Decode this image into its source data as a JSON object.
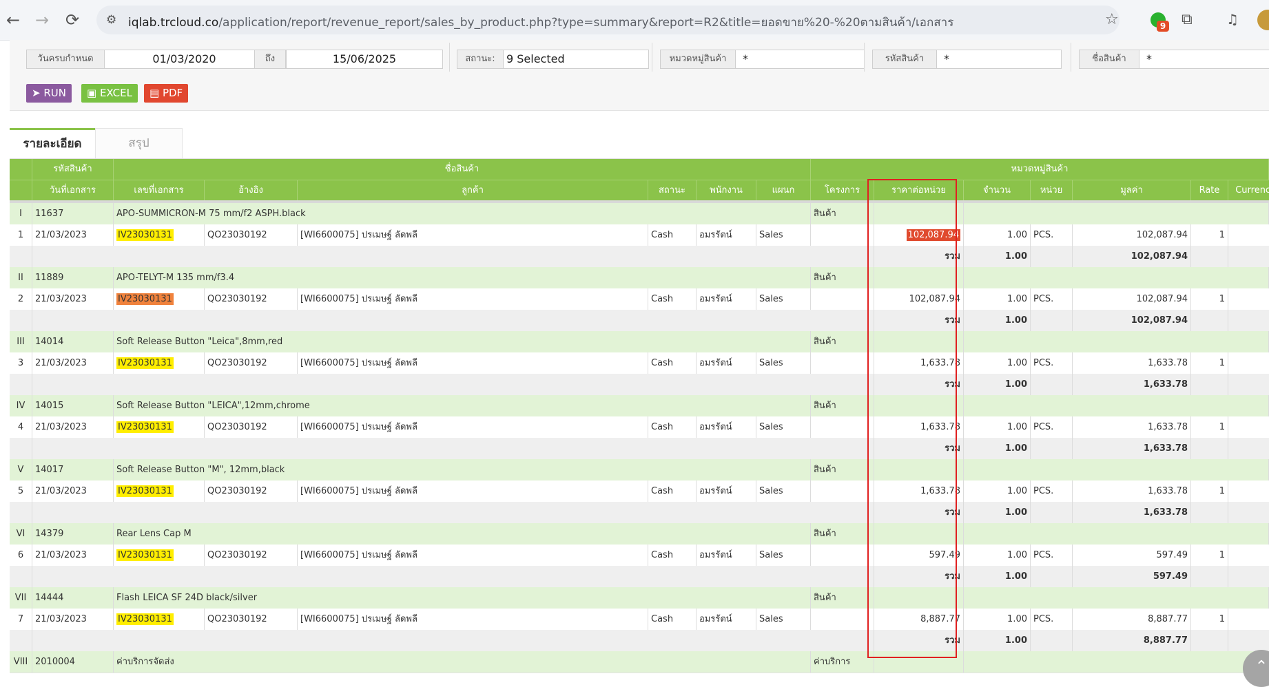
{
  "browser": {
    "url_host": "iqlab.trcloud.co",
    "url_path": "/application/report/revenue_report/sales_by_product.php?type=summary&report=R2&title=ยอดขาย%20-%20ตามสินค้า/เอกสาร",
    "ext_badge": "9"
  },
  "filters": {
    "date_label": "วันครบกำหนด",
    "date_from": "01/03/2020",
    "to_label": "ถึง",
    "date_to": "15/06/2025",
    "status_label": "สถานะ:",
    "status_value": "9 Selected",
    "category_label": "หมวดหมู่สินค้า",
    "category_value": "*",
    "code_label": "รหัสสินค้า",
    "code_value": "*",
    "name_label": "ชื่อสินค้า",
    "name_value": "*"
  },
  "buttons": {
    "run": "RUN",
    "excel": "EXCEL",
    "pdf": "PDF"
  },
  "tabs": {
    "detail": "รายละเอียด",
    "summary": "สรุป"
  },
  "header1": {
    "code": "รหัสสินค้า",
    "name": "ชื่อสินค้า",
    "category": "หมวดหมู่สินค้า"
  },
  "header2": {
    "date": "วันที่เอกสาร",
    "doc": "เลขที่เอกสาร",
    "ref": "อ้างอิง",
    "customer": "ลูกค้า",
    "status": "สถานะ",
    "employee": "พนักงาน",
    "dept": "แผนก",
    "project": "โครงการ",
    "unit_price": "ราคาต่อหน่วย",
    "qty": "จำนวน",
    "unit": "หน่วย",
    "amount": "มูลค่า",
    "rate": "Rate",
    "currency": "Currency"
  },
  "groups": [
    {
      "roman": "I",
      "code": "11637",
      "name": "APO-SUMMICRON-M 75 mm/f2 ASPH.black",
      "category": "สินค้า",
      "detail": {
        "no": "1",
        "date": "21/03/2023",
        "doc": "IV23030131",
        "ref": "QO23030192",
        "customer": "[WI6600075] ปรเมษฐ์ ลัดพลี",
        "status": "Cash",
        "employee": "อมรรัตน์",
        "dept": "Sales",
        "unit_price": "102,087.94",
        "qty": "1.00",
        "unit": "PCS.",
        "amount": "102,087.94",
        "rate": "1"
      },
      "total": {
        "label": "รวม",
        "qty": "1.00",
        "amount": "102,087.94"
      }
    },
    {
      "roman": "II",
      "code": "11889",
      "name": "APO-TELYT-M 135 mm/f3.4",
      "category": "สินค้า",
      "detail": {
        "no": "2",
        "date": "21/03/2023",
        "doc": "IV23030131",
        "ref": "QO23030192",
        "customer": "[WI6600075] ปรเมษฐ์ ลัดพลี",
        "status": "Cash",
        "employee": "อมรรัตน์",
        "dept": "Sales",
        "unit_price": "102,087.94",
        "qty": "1.00",
        "unit": "PCS.",
        "amount": "102,087.94",
        "rate": "1"
      },
      "total": {
        "label": "รวม",
        "qty": "1.00",
        "amount": "102,087.94"
      }
    },
    {
      "roman": "III",
      "code": "14014",
      "name": "Soft Release Button \"Leica\",8mm,red",
      "category": "สินค้า",
      "detail": {
        "no": "3",
        "date": "21/03/2023",
        "doc": "IV23030131",
        "ref": "QO23030192",
        "customer": "[WI6600075] ปรเมษฐ์ ลัดพลี",
        "status": "Cash",
        "employee": "อมรรัตน์",
        "dept": "Sales",
        "unit_price": "1,633.78",
        "qty": "1.00",
        "unit": "PCS.",
        "amount": "1,633.78",
        "rate": "1"
      },
      "total": {
        "label": "รวม",
        "qty": "1.00",
        "amount": "1,633.78"
      }
    },
    {
      "roman": "IV",
      "code": "14015",
      "name": "Soft Release Button \"LEICA\",12mm,chrome",
      "category": "สินค้า",
      "detail": {
        "no": "4",
        "date": "21/03/2023",
        "doc": "IV23030131",
        "ref": "QO23030192",
        "customer": "[WI6600075] ปรเมษฐ์ ลัดพลี",
        "status": "Cash",
        "employee": "อมรรัตน์",
        "dept": "Sales",
        "unit_price": "1,633.78",
        "qty": "1.00",
        "unit": "PCS.",
        "amount": "1,633.78",
        "rate": "1"
      },
      "total": {
        "label": "รวม",
        "qty": "1.00",
        "amount": "1,633.78"
      }
    },
    {
      "roman": "V",
      "code": "14017",
      "name": "Soft Release Button \"M\", 12mm,black",
      "category": "สินค้า",
      "detail": {
        "no": "5",
        "date": "21/03/2023",
        "doc": "IV23030131",
        "ref": "QO23030192",
        "customer": "[WI6600075] ปรเมษฐ์ ลัดพลี",
        "status": "Cash",
        "employee": "อมรรัตน์",
        "dept": "Sales",
        "unit_price": "1,633.78",
        "qty": "1.00",
        "unit": "PCS.",
        "amount": "1,633.78",
        "rate": "1"
      },
      "total": {
        "label": "รวม",
        "qty": "1.00",
        "amount": "1,633.78"
      }
    },
    {
      "roman": "VI",
      "code": "14379",
      "name": "Rear Lens Cap M",
      "category": "สินค้า",
      "detail": {
        "no": "6",
        "date": "21/03/2023",
        "doc": "IV23030131",
        "ref": "QO23030192",
        "customer": "[WI6600075] ปรเมษฐ์ ลัดพลี",
        "status": "Cash",
        "employee": "อมรรัตน์",
        "dept": "Sales",
        "unit_price": "597.49",
        "qty": "1.00",
        "unit": "PCS.",
        "amount": "597.49",
        "rate": "1"
      },
      "total": {
        "label": "รวม",
        "qty": "1.00",
        "amount": "597.49"
      }
    },
    {
      "roman": "VII",
      "code": "14444",
      "name": "Flash LEICA SF 24D black/silver",
      "category": "สินค้า",
      "detail": {
        "no": "7",
        "date": "21/03/2023",
        "doc": "IV23030131",
        "ref": "QO23030192",
        "customer": "[WI6600075] ปรเมษฐ์ ลัดพลี",
        "status": "Cash",
        "employee": "อมรรัตน์",
        "dept": "Sales",
        "unit_price": "8,887.77",
        "qty": "1.00",
        "unit": "PCS.",
        "amount": "8,887.77",
        "rate": "1"
      },
      "total": {
        "label": "รวม",
        "qty": "1.00",
        "amount": "8,887.77"
      }
    },
    {
      "roman": "VIII",
      "code": "2010004",
      "name": "ค่าบริการจัดส่ง",
      "category": "ค่าบริการ"
    }
  ]
}
